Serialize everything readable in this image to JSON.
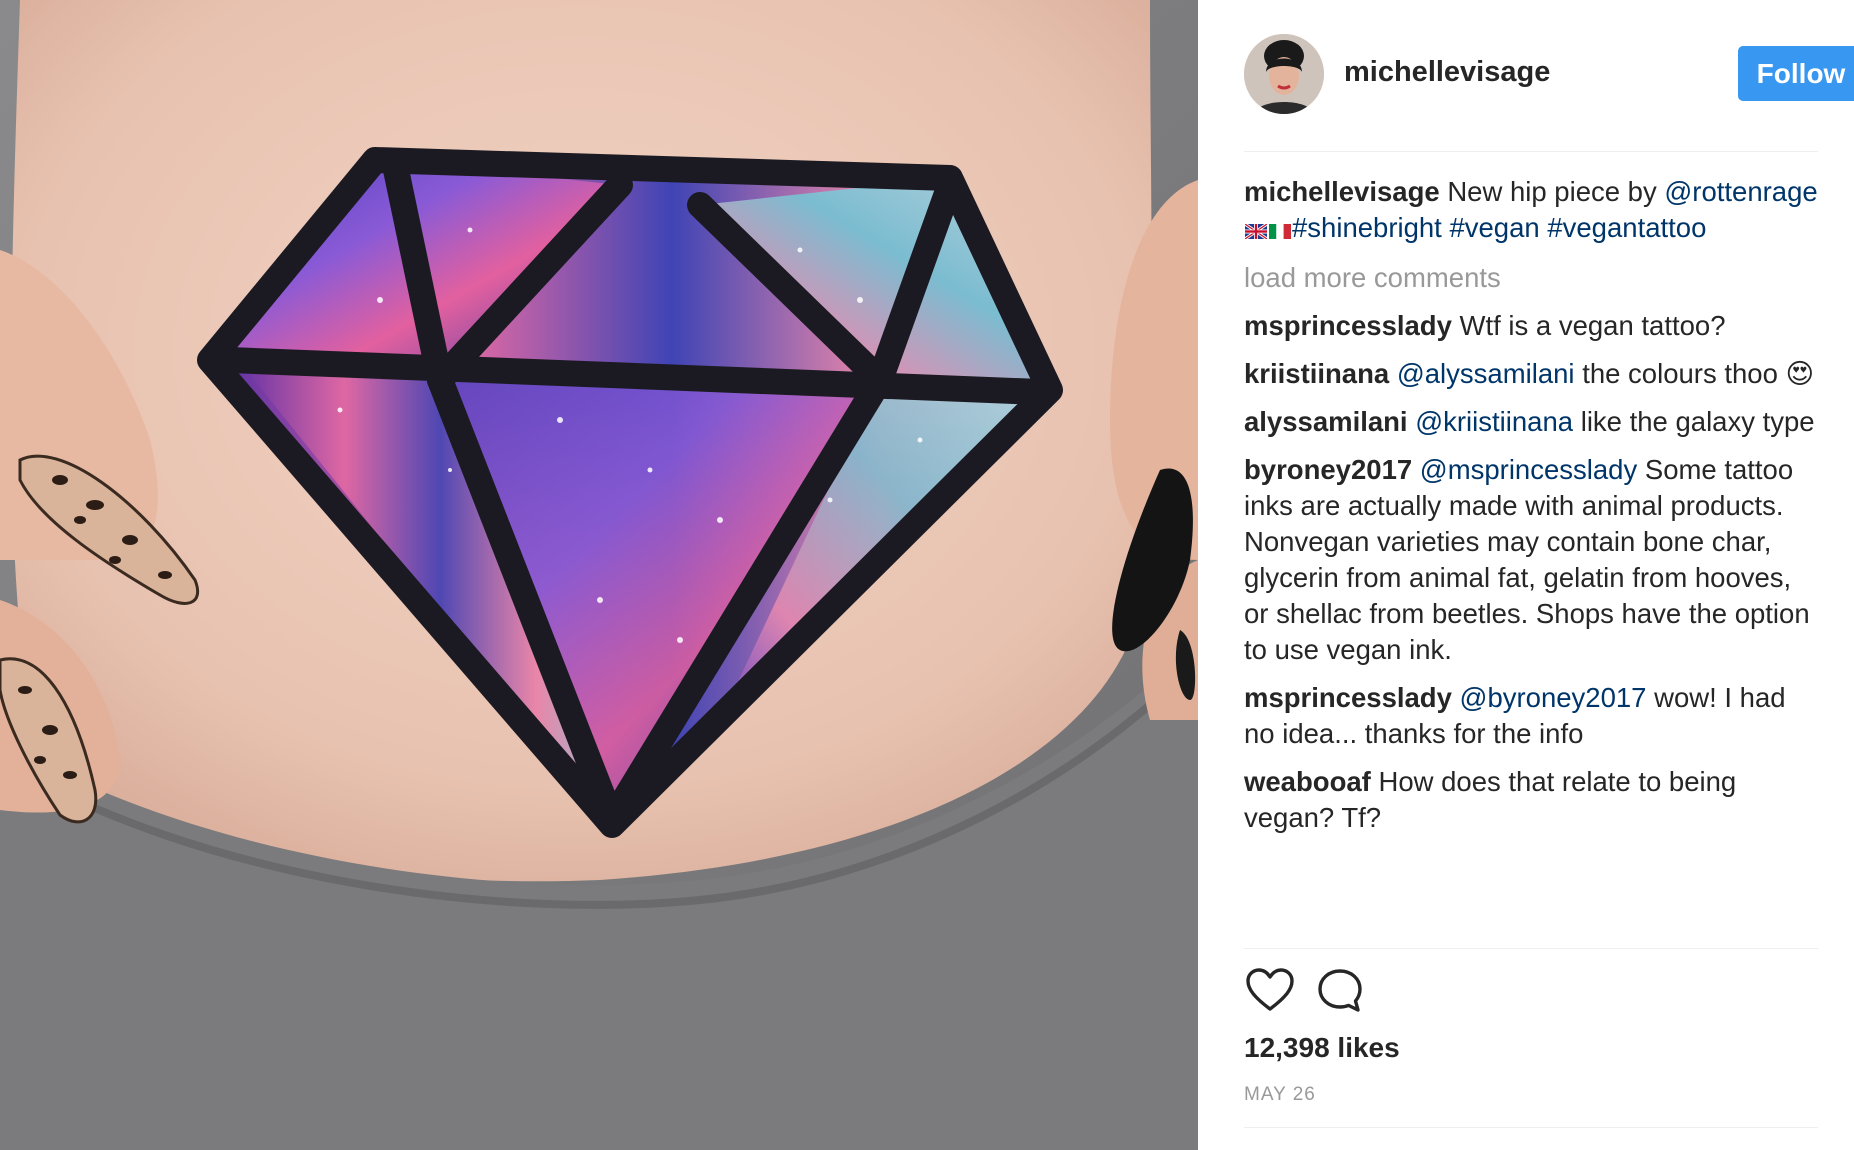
{
  "post": {
    "username": "michellevisage",
    "follow_label": "Follow",
    "caption": {
      "author": "michellevisage",
      "text_before": "New hip piece by",
      "mention": "@rottenrage",
      "hashtags": [
        "#shinebright",
        "#vegan",
        "#vegantattoo"
      ]
    },
    "load_more_label": "load more comments",
    "comments": [
      {
        "author": "msprincesslady",
        "mention": "",
        "text": "Wtf is a vegan tattoo?"
      },
      {
        "author": "kriistiinana",
        "mention": "@alyssamilani",
        "text": "the colours thoo",
        "emoji": "😍"
      },
      {
        "author": "alyssamilani",
        "mention": "@kriistiinana",
        "text": "like the galaxy type"
      },
      {
        "author": "byroney2017",
        "mention": "@msprincesslady",
        "text": "Some tattoo inks are actually made with animal products. Nonvegan varieties may contain bone char, glycerin from animal fat, gelatin from hooves, or shellac from beetles. Shops have the option to use vegan ink."
      },
      {
        "author": "msprincesslady",
        "mention": "@byroney2017",
        "text": "wow! I had no idea... thanks for the info"
      },
      {
        "author": "weabooaf",
        "mention": "",
        "text": "How does that relate to being vegan? Tf?"
      }
    ],
    "likes": "12,398 likes",
    "date": "MAY 26"
  },
  "icons": {
    "like": "heart-icon",
    "comment": "comment-bubble-icon",
    "flags": [
      "uk-flag-icon",
      "italy-flag-icon"
    ]
  },
  "colors": {
    "follow_button": "#3897f0",
    "link": "#003569",
    "muted": "#999999",
    "text": "#262626"
  }
}
